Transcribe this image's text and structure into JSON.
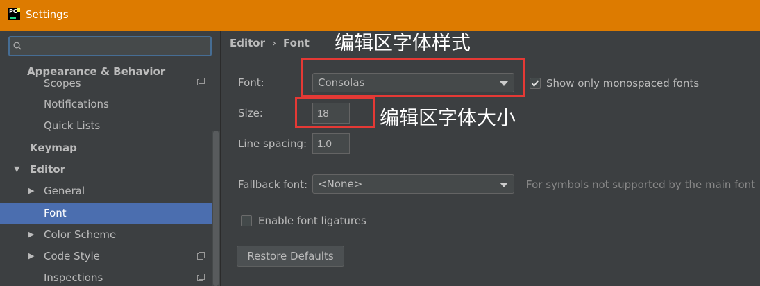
{
  "window": {
    "title": "Settings",
    "app_icon": "pycharm-icon"
  },
  "search": {
    "value": "",
    "placeholder": ""
  },
  "sidebar": {
    "items": [
      {
        "label": "Appearance & Behavior"
      },
      {
        "label": "Scopes"
      },
      {
        "label": "Notifications"
      },
      {
        "label": "Quick Lists"
      },
      {
        "label": "Keymap"
      },
      {
        "label": "Editor"
      },
      {
        "label": "General"
      },
      {
        "label": "Font"
      },
      {
        "label": "Color Scheme"
      },
      {
        "label": "Code Style"
      },
      {
        "label": "Inspections"
      }
    ],
    "selected": "Font"
  },
  "breadcrumb": {
    "parent": "Editor",
    "separator": "›",
    "current": "Font"
  },
  "annotations": {
    "font_style": "编辑区字体样式",
    "font_size": "编辑区字体大小"
  },
  "form": {
    "font_label": "Font:",
    "font_value": "Consolas",
    "mono_label": "Show only monospaced fonts",
    "mono_checked": true,
    "size_label": "Size:",
    "size_value": "18",
    "line_spacing_label": "Line spacing:",
    "line_spacing_value": "1.0",
    "fallback_label": "Fallback font:",
    "fallback_value": "<None>",
    "fallback_hint": "For symbols not supported by the main font",
    "ligatures_label": "Enable font ligatures",
    "ligatures_checked": false,
    "restore_label": "Restore Defaults"
  },
  "colors": {
    "titlebar": "#dd7b00",
    "selection": "#4b6eaf",
    "annotation_box": "#e53935"
  }
}
